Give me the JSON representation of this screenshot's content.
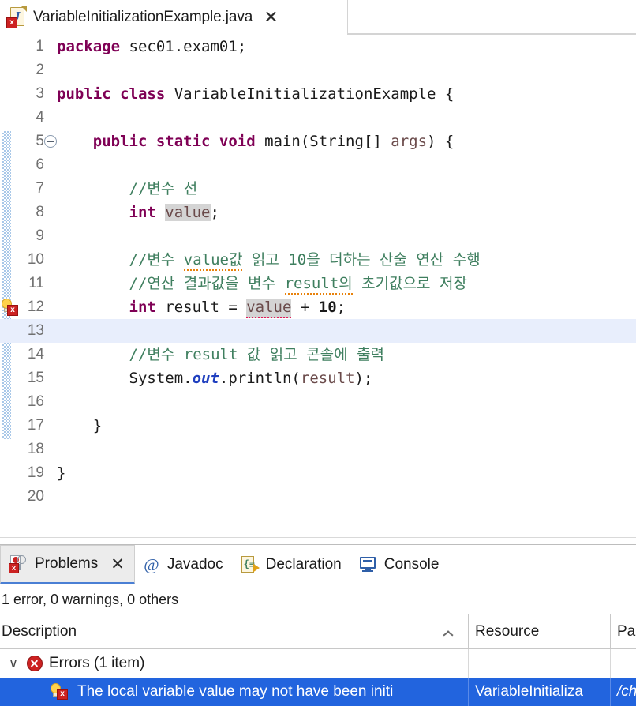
{
  "editor_tab": {
    "filename": "VariableInitializationExample.java",
    "close_label": "✕",
    "icon": "java-file-error-icon",
    "badge": "x"
  },
  "code": {
    "lines": [
      {
        "n": "1",
        "segments": [
          {
            "t": "package",
            "c": "kw"
          },
          {
            "t": " sec01.exam01;",
            "c": "plain"
          }
        ],
        "indent": 0
      },
      {
        "n": "2",
        "segments": [],
        "indent": 0
      },
      {
        "n": "3",
        "segments": [
          {
            "t": "public class",
            "c": "kw"
          },
          {
            "t": " VariableInitializationExample {",
            "c": "plain"
          }
        ],
        "indent": 0
      },
      {
        "n": "4",
        "segments": [],
        "indent": 0
      },
      {
        "n": "5",
        "segments": [
          {
            "t": "public static void",
            "c": "kw"
          },
          {
            "t": " main(String[] ",
            "c": "plain"
          },
          {
            "t": "args",
            "c": "var"
          },
          {
            "t": ") {",
            "c": "plain"
          }
        ],
        "indent": 1,
        "fold": true
      },
      {
        "n": "6",
        "segments": [],
        "indent": 0
      },
      {
        "n": "7",
        "segments": [
          {
            "t": "//변수 선",
            "c": "cmt"
          }
        ],
        "indent": 2
      },
      {
        "n": "8",
        "segments": [
          {
            "t": "int",
            "c": "kw"
          },
          {
            "t": " ",
            "c": "plain"
          },
          {
            "t": "value",
            "c": "var hl-occ"
          },
          {
            "t": ";",
            "c": "plain"
          }
        ],
        "indent": 2
      },
      {
        "n": "9",
        "segments": [],
        "indent": 0
      },
      {
        "n": "10",
        "segments": [
          {
            "t": "//변수 ",
            "c": "cmt"
          },
          {
            "t": "value값",
            "c": "cmt sq-orange"
          },
          {
            "t": " 읽고 10을 더하는 산술 연산 수행",
            "c": "cmt"
          }
        ],
        "indent": 2
      },
      {
        "n": "11",
        "segments": [
          {
            "t": "//연산 결과값을 변수 ",
            "c": "cmt"
          },
          {
            "t": "result의",
            "c": "cmt sq-orange"
          },
          {
            "t": " 초기값으로 저장",
            "c": "cmt"
          }
        ],
        "indent": 2
      },
      {
        "n": "12",
        "segments": [
          {
            "t": "int",
            "c": "kw"
          },
          {
            "t": " result = ",
            "c": "plain"
          },
          {
            "t": "value",
            "c": "var hl-occ sq-red"
          },
          {
            "t": " + ",
            "c": "plain"
          },
          {
            "t": "10",
            "c": "num"
          },
          {
            "t": ";",
            "c": "plain"
          }
        ],
        "indent": 2,
        "marker": "quickfix-error"
      },
      {
        "n": "13",
        "segments": [],
        "indent": 0,
        "current": true
      },
      {
        "n": "14",
        "segments": [
          {
            "t": "//변수 result 값 읽고 콘솔에 출력",
            "c": "cmt"
          }
        ],
        "indent": 2
      },
      {
        "n": "15",
        "segments": [
          {
            "t": "System.",
            "c": "plain"
          },
          {
            "t": "out",
            "c": "field"
          },
          {
            "t": ".println(",
            "c": "plain"
          },
          {
            "t": "result",
            "c": "var"
          },
          {
            "t": ");",
            "c": "plain"
          }
        ],
        "indent": 2
      },
      {
        "n": "16",
        "segments": [],
        "indent": 0
      },
      {
        "n": "17",
        "segments": [
          {
            "t": "}",
            "c": "plain"
          }
        ],
        "indent": 1
      },
      {
        "n": "18",
        "segments": [],
        "indent": 0
      },
      {
        "n": "19",
        "segments": [
          {
            "t": "}",
            "c": "plain"
          }
        ],
        "indent": 0
      },
      {
        "n": "20",
        "segments": [],
        "indent": 0
      }
    ]
  },
  "panel": {
    "tabs": [
      {
        "label": "Problems",
        "icon": "problems-icon",
        "active": true,
        "closable": true,
        "close_label": "✕"
      },
      {
        "label": "Javadoc",
        "icon": "javadoc-at-icon",
        "active": false,
        "closable": false
      },
      {
        "label": "Declaration",
        "icon": "declaration-icon",
        "active": false,
        "closable": false
      },
      {
        "label": "Console",
        "icon": "console-icon",
        "active": false,
        "closable": false
      }
    ],
    "summary": "1 error, 0 warnings, 0 others",
    "columns": [
      {
        "key": "description",
        "label": "Description",
        "sort": "asc"
      },
      {
        "key": "resource",
        "label": "Resource"
      },
      {
        "key": "path",
        "label": "Pa"
      }
    ],
    "rows": [
      {
        "kind": "group",
        "twisty": "∨",
        "icon": "error-circle-icon",
        "description": "Errors (1 item)",
        "resource": "",
        "path": ""
      },
      {
        "kind": "item",
        "selected": true,
        "icon": "quickfix-error-icon",
        "badge": "x",
        "description": "The local variable value may not have been initi",
        "resource": "VariableInitializa",
        "path": "/ch"
      }
    ]
  },
  "colors": {
    "keyword": "#7f0055",
    "comment": "#3f7f5f",
    "field": "#1f3fbf",
    "local_var": "#6a4a4a",
    "selection": "#2264de",
    "current_line": "#e8eefc",
    "occurrence_highlight": "#d4d4d4",
    "spell_squiggle": "#e8820c",
    "error_squiggle": "#e01b5a",
    "active_tab_underline": "#4a7fd4"
  }
}
